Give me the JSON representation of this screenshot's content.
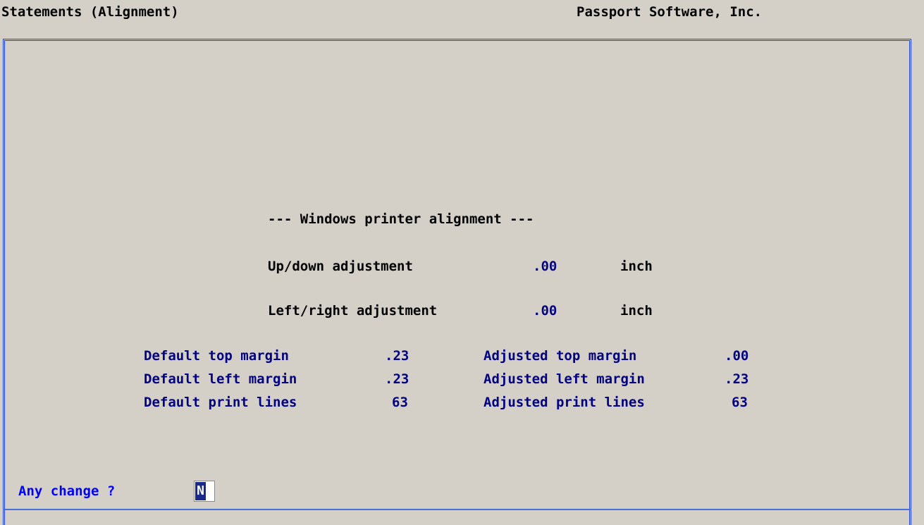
{
  "header": {
    "title": "Statements (Alignment)",
    "company": "Passport Software, Inc."
  },
  "alignment": {
    "heading": "--- Windows printer alignment ---",
    "updown_label": "Up/down adjustment",
    "updown_value": ".00",
    "updown_unit": "inch",
    "leftright_label": "Left/right adjustment",
    "leftright_value": ".00",
    "leftright_unit": "inch"
  },
  "margins": {
    "default_top_label": "Default top margin",
    "default_top_value": ".23",
    "default_left_label": "Default left margin",
    "default_left_value": ".23",
    "default_lines_label": "Default print lines",
    "default_lines_value": "63",
    "adjusted_top_label": "Adjusted top margin",
    "adjusted_top_value": ".00",
    "adjusted_left_label": "Adjusted left margin",
    "adjusted_left_value": ".23",
    "adjusted_lines_label": "Adjusted print lines",
    "adjusted_lines_value": "63"
  },
  "prompt": {
    "question": "Any change ?",
    "value": "N"
  },
  "colors": {
    "background": "#d4d0c8",
    "border": "#1f3fff",
    "label": "#000080",
    "prompt": "#0000ff"
  }
}
